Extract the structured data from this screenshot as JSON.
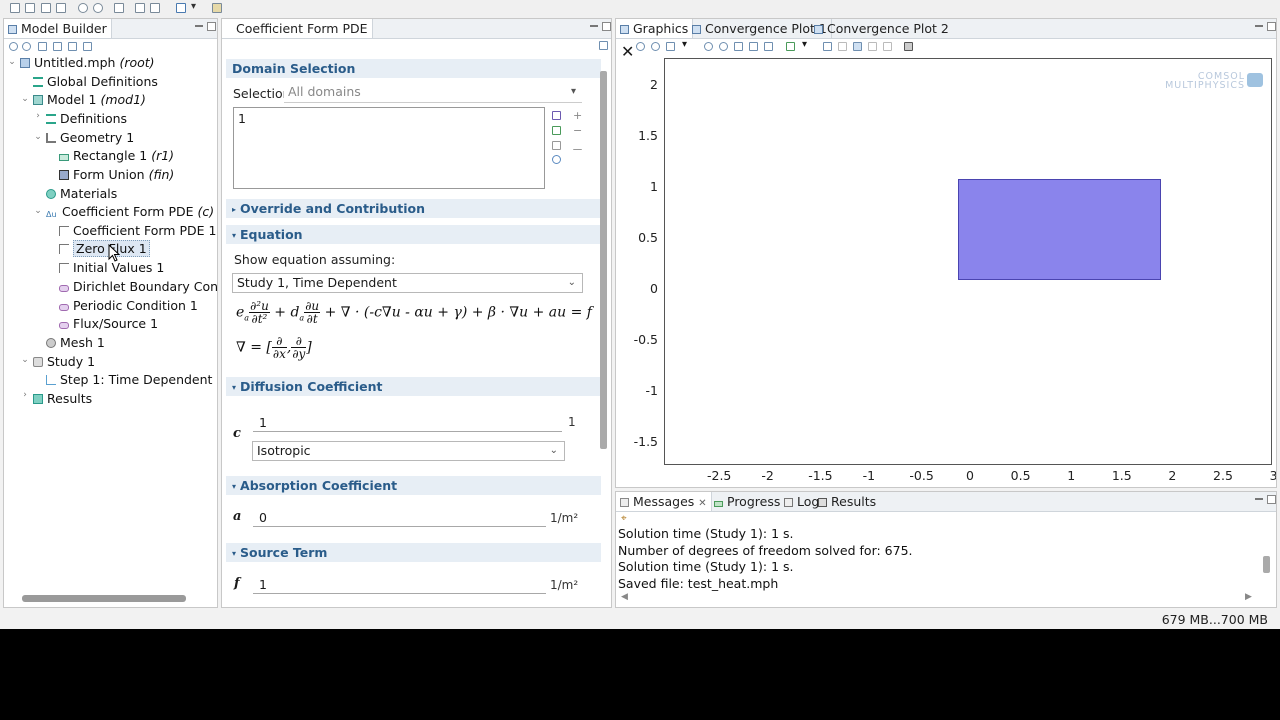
{
  "model_builder": {
    "tab_label": "Model Builder",
    "tree": [
      {
        "label": "Untitled.mph",
        "suffix": "(root)"
      },
      {
        "label": "Global Definitions",
        "suffix": ""
      },
      {
        "label": "Model 1",
        "suffix": "(mod1)"
      },
      {
        "label": "Definitions",
        "suffix": ""
      },
      {
        "label": "Geometry 1",
        "suffix": ""
      },
      {
        "label": "Rectangle 1",
        "suffix": "(r1)"
      },
      {
        "label": "Form Union",
        "suffix": "(fin)"
      },
      {
        "label": "Materials",
        "suffix": ""
      },
      {
        "label": "Coefficient Form PDE",
        "suffix": "(c)"
      },
      {
        "label": "Coefficient Form PDE 1",
        "suffix": ""
      },
      {
        "label": "Zero Flux 1",
        "suffix": ""
      },
      {
        "label": "Initial Values 1",
        "suffix": ""
      },
      {
        "label": "Dirichlet Boundary Conditio",
        "suffix": ""
      },
      {
        "label": "Periodic Condition 1",
        "suffix": ""
      },
      {
        "label": "Flux/Source 1",
        "suffix": ""
      },
      {
        "label": "Mesh 1",
        "suffix": ""
      },
      {
        "label": "Study 1",
        "suffix": ""
      },
      {
        "label": "Step 1: Time Dependent",
        "suffix": ""
      },
      {
        "label": "Results",
        "suffix": ""
      }
    ]
  },
  "settings": {
    "tab_label": "Coefficient Form PDE",
    "domain_selection": {
      "title": "Domain Selection",
      "selection_label": "Selection:",
      "selection_value": "All domains",
      "list_item": "1"
    },
    "override_title": "Override and Contribution",
    "equation": {
      "title": "Equation",
      "show_label": "Show equation assuming:",
      "study_value": "Study 1, Time Dependent"
    },
    "diffusion": {
      "title": "Diffusion Coefficient",
      "symbol": "c",
      "value": "1",
      "unit": "1",
      "type": "Isotropic"
    },
    "absorption": {
      "title": "Absorption Coefficient",
      "symbol": "a",
      "value": "0",
      "unit": "1/m²"
    },
    "source": {
      "title": "Source Term",
      "symbol": "f",
      "value": "1",
      "unit": "1/m²"
    }
  },
  "graphics": {
    "tabs": [
      "Graphics",
      "Convergence Plot 1",
      "Convergence Plot 2"
    ],
    "logo_line1": "COMSOL",
    "logo_line2": "MULTIPHYSICS",
    "x_ticks": [
      "-2.5",
      "-2",
      "-1.5",
      "-1",
      "-0.5",
      "0",
      "0.5",
      "1",
      "1.5",
      "2",
      "2.5",
      "3"
    ],
    "y_ticks": [
      "2",
      "1.5",
      "1",
      "0.5",
      "0",
      "-0.5",
      "-1",
      "-1.5"
    ],
    "rect_color": "#8a84ec",
    "rect_edge": "#4a44b0"
  },
  "messages": {
    "tabs": [
      "Messages",
      "Progress",
      "Log",
      "Results"
    ],
    "lines": [
      "Solution time (Study 1): 1 s.",
      "Number of degrees of freedom solved for: 675.",
      "Solution time (Study 1): 1 s.",
      "Saved file: test_heat.mph"
    ]
  },
  "status": {
    "memory": "679 MB...700 MB"
  }
}
